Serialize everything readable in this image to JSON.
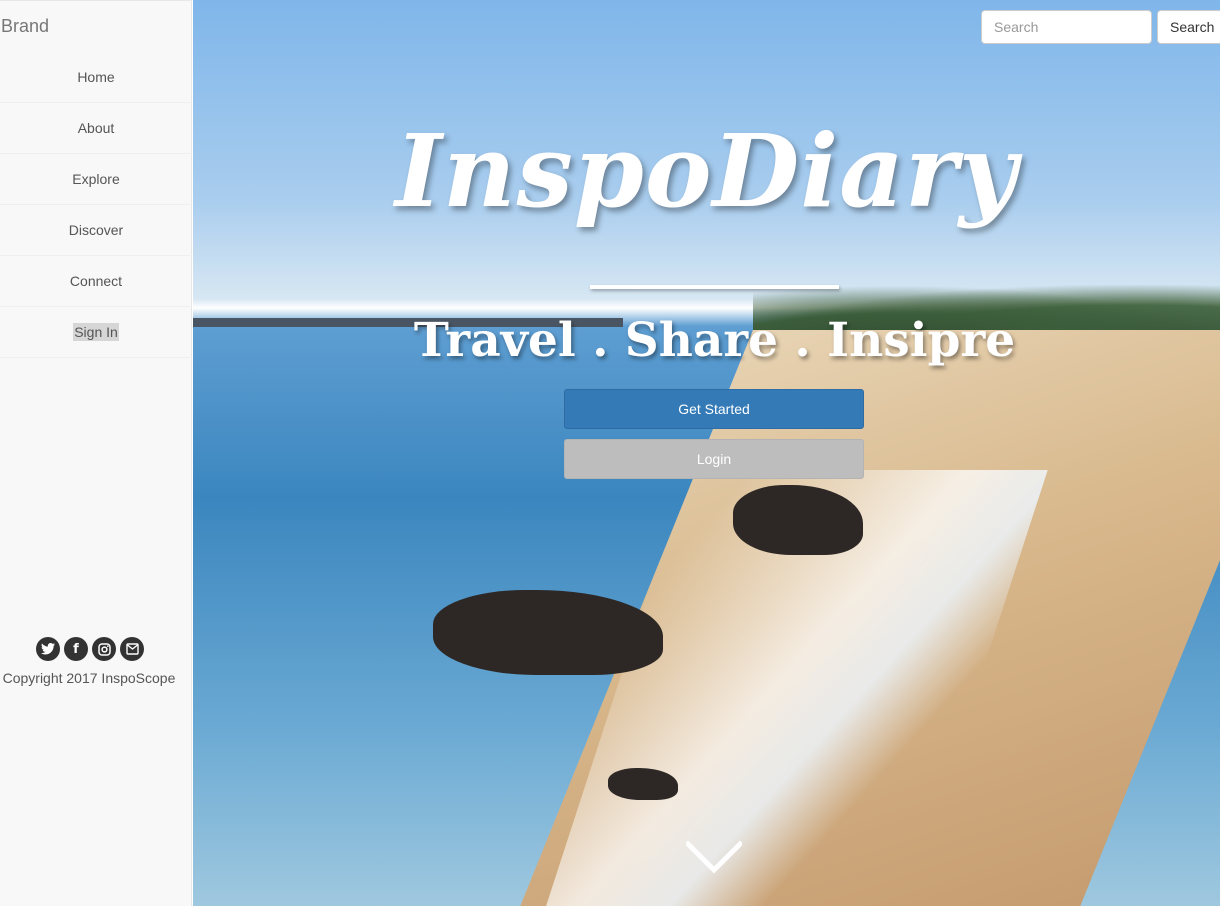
{
  "sidebar": {
    "brand": "Brand",
    "items": [
      {
        "label": "Home"
      },
      {
        "label": "About"
      },
      {
        "label": "Explore"
      },
      {
        "label": "Discover"
      },
      {
        "label": "Connect"
      },
      {
        "label": "Sign In"
      }
    ],
    "social": [
      "twitter-icon",
      "facebook-icon",
      "instagram-icon",
      "mail-icon"
    ],
    "copyright": "Copyright 2017 InspoScope"
  },
  "search": {
    "placeholder": "Search",
    "button_label": "Search"
  },
  "hero": {
    "title": "InspoDiary",
    "tagline": "Travel . Share . Insipre",
    "primary_button": "Get Started",
    "secondary_button": "Login",
    "scroll_icon": "chevron-down-icon"
  },
  "colors": {
    "primary": "#337ab7",
    "secondary": "#bdbdbd",
    "sidebar_bg": "#f8f8f8"
  }
}
